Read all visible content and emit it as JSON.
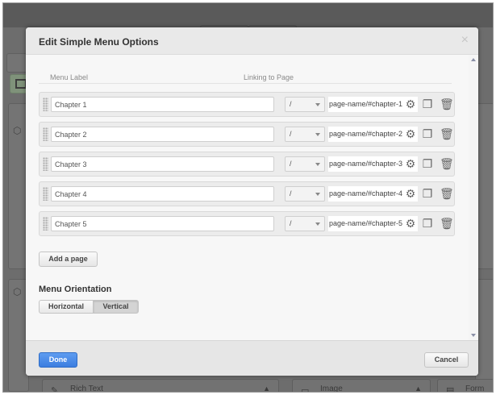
{
  "modal": {
    "title": "Edit Simple Menu Options",
    "close_glyph": "×"
  },
  "columns": {
    "menu_label": "Menu Label",
    "linking_to_page": "Linking to Page"
  },
  "rows": [
    {
      "label": "Chapter 1",
      "page": "/",
      "link": "page-name/#chapter-1"
    },
    {
      "label": "Chapter 2",
      "page": "/",
      "link": "page-name/#chapter-2"
    },
    {
      "label": "Chapter 3",
      "page": "/",
      "link": "page-name/#chapter-3"
    },
    {
      "label": "Chapter 4",
      "page": "/",
      "link": "page-name/#chapter-4"
    },
    {
      "label": "Chapter 5",
      "page": "/",
      "link": "page-name/#chapter-5"
    }
  ],
  "buttons": {
    "add_page": "Add a page",
    "done": "Done",
    "cancel": "Cancel"
  },
  "orientation": {
    "title": "Menu Orientation",
    "options": [
      "Horizontal",
      "Vertical"
    ],
    "selected": "Vertical"
  },
  "background": {
    "bottom_items": [
      "Rich Text",
      "Image",
      "Form"
    ]
  },
  "icons": {
    "row_settings": "gear-icon",
    "row_duplicate": "copy-icon",
    "row_delete": "trash-icon",
    "drag": "drag-handle-icon"
  },
  "colors": {
    "primary_button": "#3c7ee0",
    "overlay": "#6d6d6d",
    "modal_bg": "#f7f7f7"
  }
}
